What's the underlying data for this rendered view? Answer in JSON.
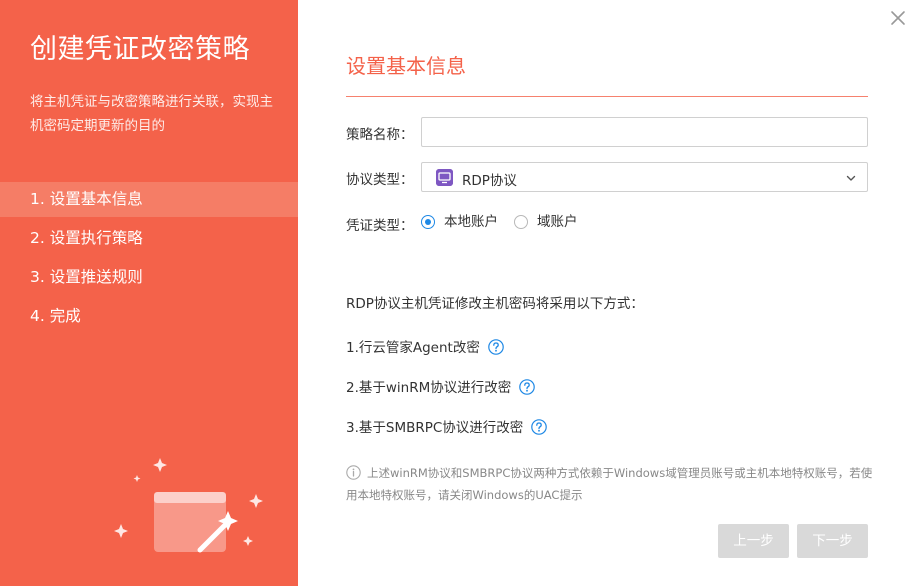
{
  "left": {
    "title": "创建凭证改密策略",
    "description": "将主机凭证与改密策略进行关联，实现主机密码定期更新的目的",
    "steps": [
      {
        "label": "1. 设置基本信息",
        "active": true
      },
      {
        "label": "2. 设置执行策略",
        "active": false
      },
      {
        "label": "3. 设置推送规则",
        "active": false
      },
      {
        "label": "4. 完成",
        "active": false
      }
    ]
  },
  "form": {
    "section_title": "设置基本信息",
    "policy_name_label": "策略名称：",
    "policy_name_value": "",
    "protocol_label": "协议类型：",
    "protocol_value": "RDP协议",
    "protocol_icon": "rdp-protocol-icon",
    "credential_label": "凭证类型：",
    "credential_options": [
      {
        "label": "本地账户",
        "checked": true
      },
      {
        "label": "域账户",
        "checked": false
      }
    ]
  },
  "methods": {
    "intro": "RDP协议主机凭证修改主机密码将采用以下方式：",
    "items": [
      "1.行云管家Agent改密",
      "2.基于winRM协议进行改密",
      "3.基于SMBRPC协议进行改密"
    ]
  },
  "note": "上述winRM协议和SMBRPC协议两种方式依赖于Windows域管理员账号或主机本地特权账号，若使用本地特权账号，请关闭Windows的UAC提示",
  "buttons": {
    "prev": "上一步",
    "next": "下一步"
  },
  "colors": {
    "accent": "#f4624a",
    "active_step": "#f57d66",
    "radio_checked": "#1e88e5",
    "help_icon": "#1e88e5",
    "button_disabled": "#d9d9d9"
  }
}
